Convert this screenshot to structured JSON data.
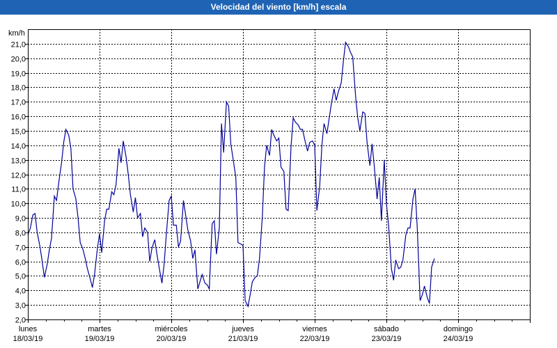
{
  "window": {
    "title": "Velocidad del viento [km/h] escala"
  },
  "chart_data": {
    "type": "line",
    "ylabel": "km/h",
    "ylim": [
      2.0,
      22.0
    ],
    "yticks": [
      2.0,
      3.0,
      4.0,
      5.0,
      6.0,
      7.0,
      8.0,
      9.0,
      10.0,
      11.0,
      12.0,
      13.0,
      14.0,
      15.0,
      16.0,
      17.0,
      18.0,
      19.0,
      20.0,
      21.0
    ],
    "ytick_labels": [
      "2,0",
      "3,0",
      "4,0",
      "5,0",
      "6,0",
      "7,0",
      "8,0",
      "9,0",
      "10,0",
      "11,0",
      "12,0",
      "13,0",
      "14,0",
      "15,0",
      "16,0",
      "17,0",
      "18,0",
      "19,0",
      "20,0",
      "21,0"
    ],
    "x_unit": "days since 18/03/19 00:00",
    "xlim": [
      0,
      7
    ],
    "day_labels": [
      {
        "day": "lunes",
        "date": "18/03/19"
      },
      {
        "day": "martes",
        "date": "19/03/19"
      },
      {
        "day": "miércoles",
        "date": "20/03/19"
      },
      {
        "day": "jueves",
        "date": "21/03/19"
      },
      {
        "day": "viernes",
        "date": "22/03/19"
      },
      {
        "day": "sábado",
        "date": "23/03/19"
      },
      {
        "day": "domingo",
        "date": "24/03/19"
      }
    ],
    "grid": true,
    "color": "#000099",
    "x": [
      0,
      0.035,
      0.07,
      0.1,
      0.13,
      0.17,
      0.2,
      0.23,
      0.27,
      0.3,
      0.33,
      0.37,
      0.4,
      0.43,
      0.47,
      0.5,
      0.53,
      0.57,
      0.6,
      0.63,
      0.67,
      0.7,
      0.73,
      0.77,
      0.8,
      0.83,
      0.87,
      0.9,
      0.93,
      0.97,
      1.0,
      1.03,
      1.07,
      1.1,
      1.13,
      1.17,
      1.2,
      1.23,
      1.27,
      1.3,
      1.33,
      1.37,
      1.4,
      1.43,
      1.47,
      1.5,
      1.53,
      1.57,
      1.6,
      1.63,
      1.67,
      1.7,
      1.73,
      1.77,
      1.8,
      1.83,
      1.87,
      1.9,
      1.93,
      1.97,
      2.0,
      2.03,
      2.07,
      2.1,
      2.13,
      2.17,
      2.2,
      2.23,
      2.27,
      2.3,
      2.33,
      2.37,
      2.4,
      2.43,
      2.47,
      2.5,
      2.53,
      2.57,
      2.6,
      2.63,
      2.67,
      2.7,
      2.73,
      2.77,
      2.8,
      2.83,
      2.87,
      2.9,
      2.93,
      2.97,
      3.0,
      3.03,
      3.07,
      3.1,
      3.13,
      3.17,
      3.2,
      3.23,
      3.27,
      3.3,
      3.33,
      3.37,
      3.4,
      3.43,
      3.47,
      3.5,
      3.53,
      3.57,
      3.6,
      3.63,
      3.67,
      3.7,
      3.73,
      3.77,
      3.8,
      3.83,
      3.87,
      3.9,
      3.93,
      3.97,
      4.0,
      4.03,
      4.07,
      4.1,
      4.13,
      4.17,
      4.2,
      4.23,
      4.27,
      4.3,
      4.33,
      4.37,
      4.4,
      4.43,
      4.47,
      4.5,
      4.53,
      4.57,
      4.6,
      4.63,
      4.67,
      4.7,
      4.73,
      4.77,
      4.8,
      4.83,
      4.87,
      4.9,
      4.93,
      4.97,
      5.0,
      5.03,
      5.07,
      5.1,
      5.13,
      5.17,
      5.2,
      5.23,
      5.27,
      5.3,
      5.33,
      5.37,
      5.4,
      5.43,
      5.47,
      5.5,
      5.53,
      5.57,
      5.6,
      5.63,
      5.67,
      5.7,
      5.73,
      5.77,
      5.8,
      5.83,
      5.87,
      5.9,
      5.93,
      5.97,
      6.0,
      6.03,
      6.07,
      6.1,
      6.13,
      6.17,
      6.2,
      6.23,
      6.27,
      6.3,
      6.33,
      6.37,
      6.4,
      6.43,
      6.47,
      6.5,
      6.53,
      6.57,
      6.6,
      6.63,
      6.67,
      6.7,
      6.73,
      6.77,
      6.8,
      6.83,
      6.87,
      6.9,
      6.93,
      6.97,
      7.0
    ],
    "y": [
      7.8,
      8.3,
      9.2,
      9.3,
      8.0,
      7.0,
      6.0,
      4.9,
      5.8,
      6.8,
      7.6,
      10.5,
      10.2,
      11.4,
      12.8,
      14.2,
      15.1,
      14.7,
      13.8,
      11.0,
      10.3,
      9.0,
      7.3,
      6.8,
      6.2,
      5.5,
      4.8,
      4.2,
      5.1,
      6.9,
      7.9,
      6.6,
      8.8,
      9.6,
      9.6,
      10.8,
      10.6,
      11.3,
      13.8,
      12.8,
      14.3,
      13.2,
      12.0,
      10.6,
      9.4,
      10.4,
      9.0,
      9.3,
      7.7,
      8.3,
      8.0,
      6.0,
      6.9,
      7.5,
      6.5,
      5.6,
      4.5,
      5.8,
      7.8,
      10.2,
      10.5,
      8.5,
      8.5,
      7.0,
      7.4,
      10.2,
      9.2,
      8.2,
      7.4,
      6.2,
      6.8,
      4.1,
      4.6,
      5.1,
      4.5,
      4.4,
      4.1,
      8.6,
      8.8,
      6.5,
      8.3,
      15.5,
      13.5,
      17.0,
      16.7,
      14.1,
      12.8,
      11.8,
      7.3,
      7.2,
      7.1,
      3.3,
      2.9,
      3.7,
      4.6,
      4.9,
      5.0,
      6.2,
      9.1,
      12.5,
      14.0,
      13.3,
      15.1,
      14.7,
      14.3,
      14.5,
      12.5,
      12.2,
      9.6,
      9.5,
      13.9,
      15.9,
      15.6,
      15.4,
      15.1,
      15.1,
      14.2,
      13.6,
      14.2,
      14.3,
      14.0,
      9.5,
      11.2,
      14.0,
      15.5,
      14.8,
      15.8,
      16.8,
      17.9,
      17.1,
      17.7,
      18.3,
      19.8,
      21.1,
      20.8,
      20.4,
      20.1,
      17.4,
      15.9,
      15.0,
      16.3,
      16.2,
      14.2,
      12.6,
      14.1,
      12.6,
      10.3,
      11.8,
      8.8,
      13.0,
      10.0,
      8.5,
      5.5,
      4.7,
      6.1,
      5.5,
      5.6,
      6.1,
      7.8,
      8.3,
      8.3,
      10.3,
      11.0,
      8.3,
      3.3,
      3.7,
      4.3,
      3.5,
      3.1,
      5.6,
      6.2
    ]
  }
}
